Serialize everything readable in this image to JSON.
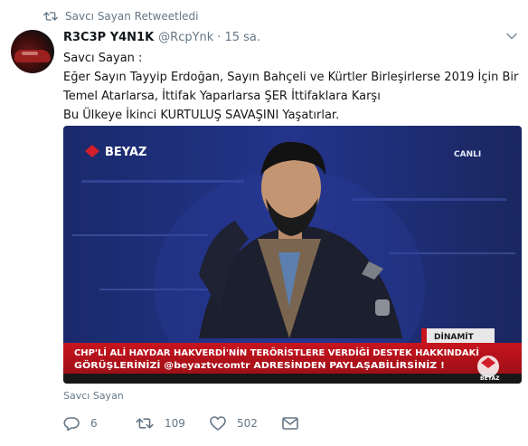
{
  "retweet": {
    "label": "Savcı Sayan Retweetledi",
    "icon": "retweet-icon"
  },
  "author": {
    "name": "R3C3P Y4N1K",
    "handle": "@RcpYnk",
    "separator": "·",
    "time": "15 sa."
  },
  "tweet_text": [
    "Savcı Sayan :",
    "Eğer Sayın Tayyip Erdoğan, Sayın Bahçeli ve Kürtler Birleşirlerse 2019 İçin Bir",
    "Temel Atarlarsa, İttifak Yaparlarsa ŞER İttifaklara Karşı",
    "Bu Ülkeye İkinci KURTULUŞ SAVAŞINI Yaşatırlar."
  ],
  "media": {
    "channel_logo": "BEYAZ",
    "live_label": "CANLI",
    "program_label": "DİNAMİT",
    "ticker_line1": "CHP'Lİ ALİ HAYDAR HAKVERDİ'NİN TERÖRİSTLERE VERDİĞİ DESTEK HAKKINDAKİ",
    "ticker_line2": "GÖRÜŞLERİNİZİ @beyaztvcomtr ADRESİNDEN PAYLAŞABİLİRSİNİZ !",
    "corner_logo": "BEYAZ"
  },
  "media_caption": "Savcı Sayan",
  "actions": {
    "reply_count": "6",
    "retweet_count": "109",
    "like_count": "502"
  },
  "colors": {
    "muted": "#657786",
    "ticker_red": "#b3121b",
    "text": "#14171a"
  }
}
